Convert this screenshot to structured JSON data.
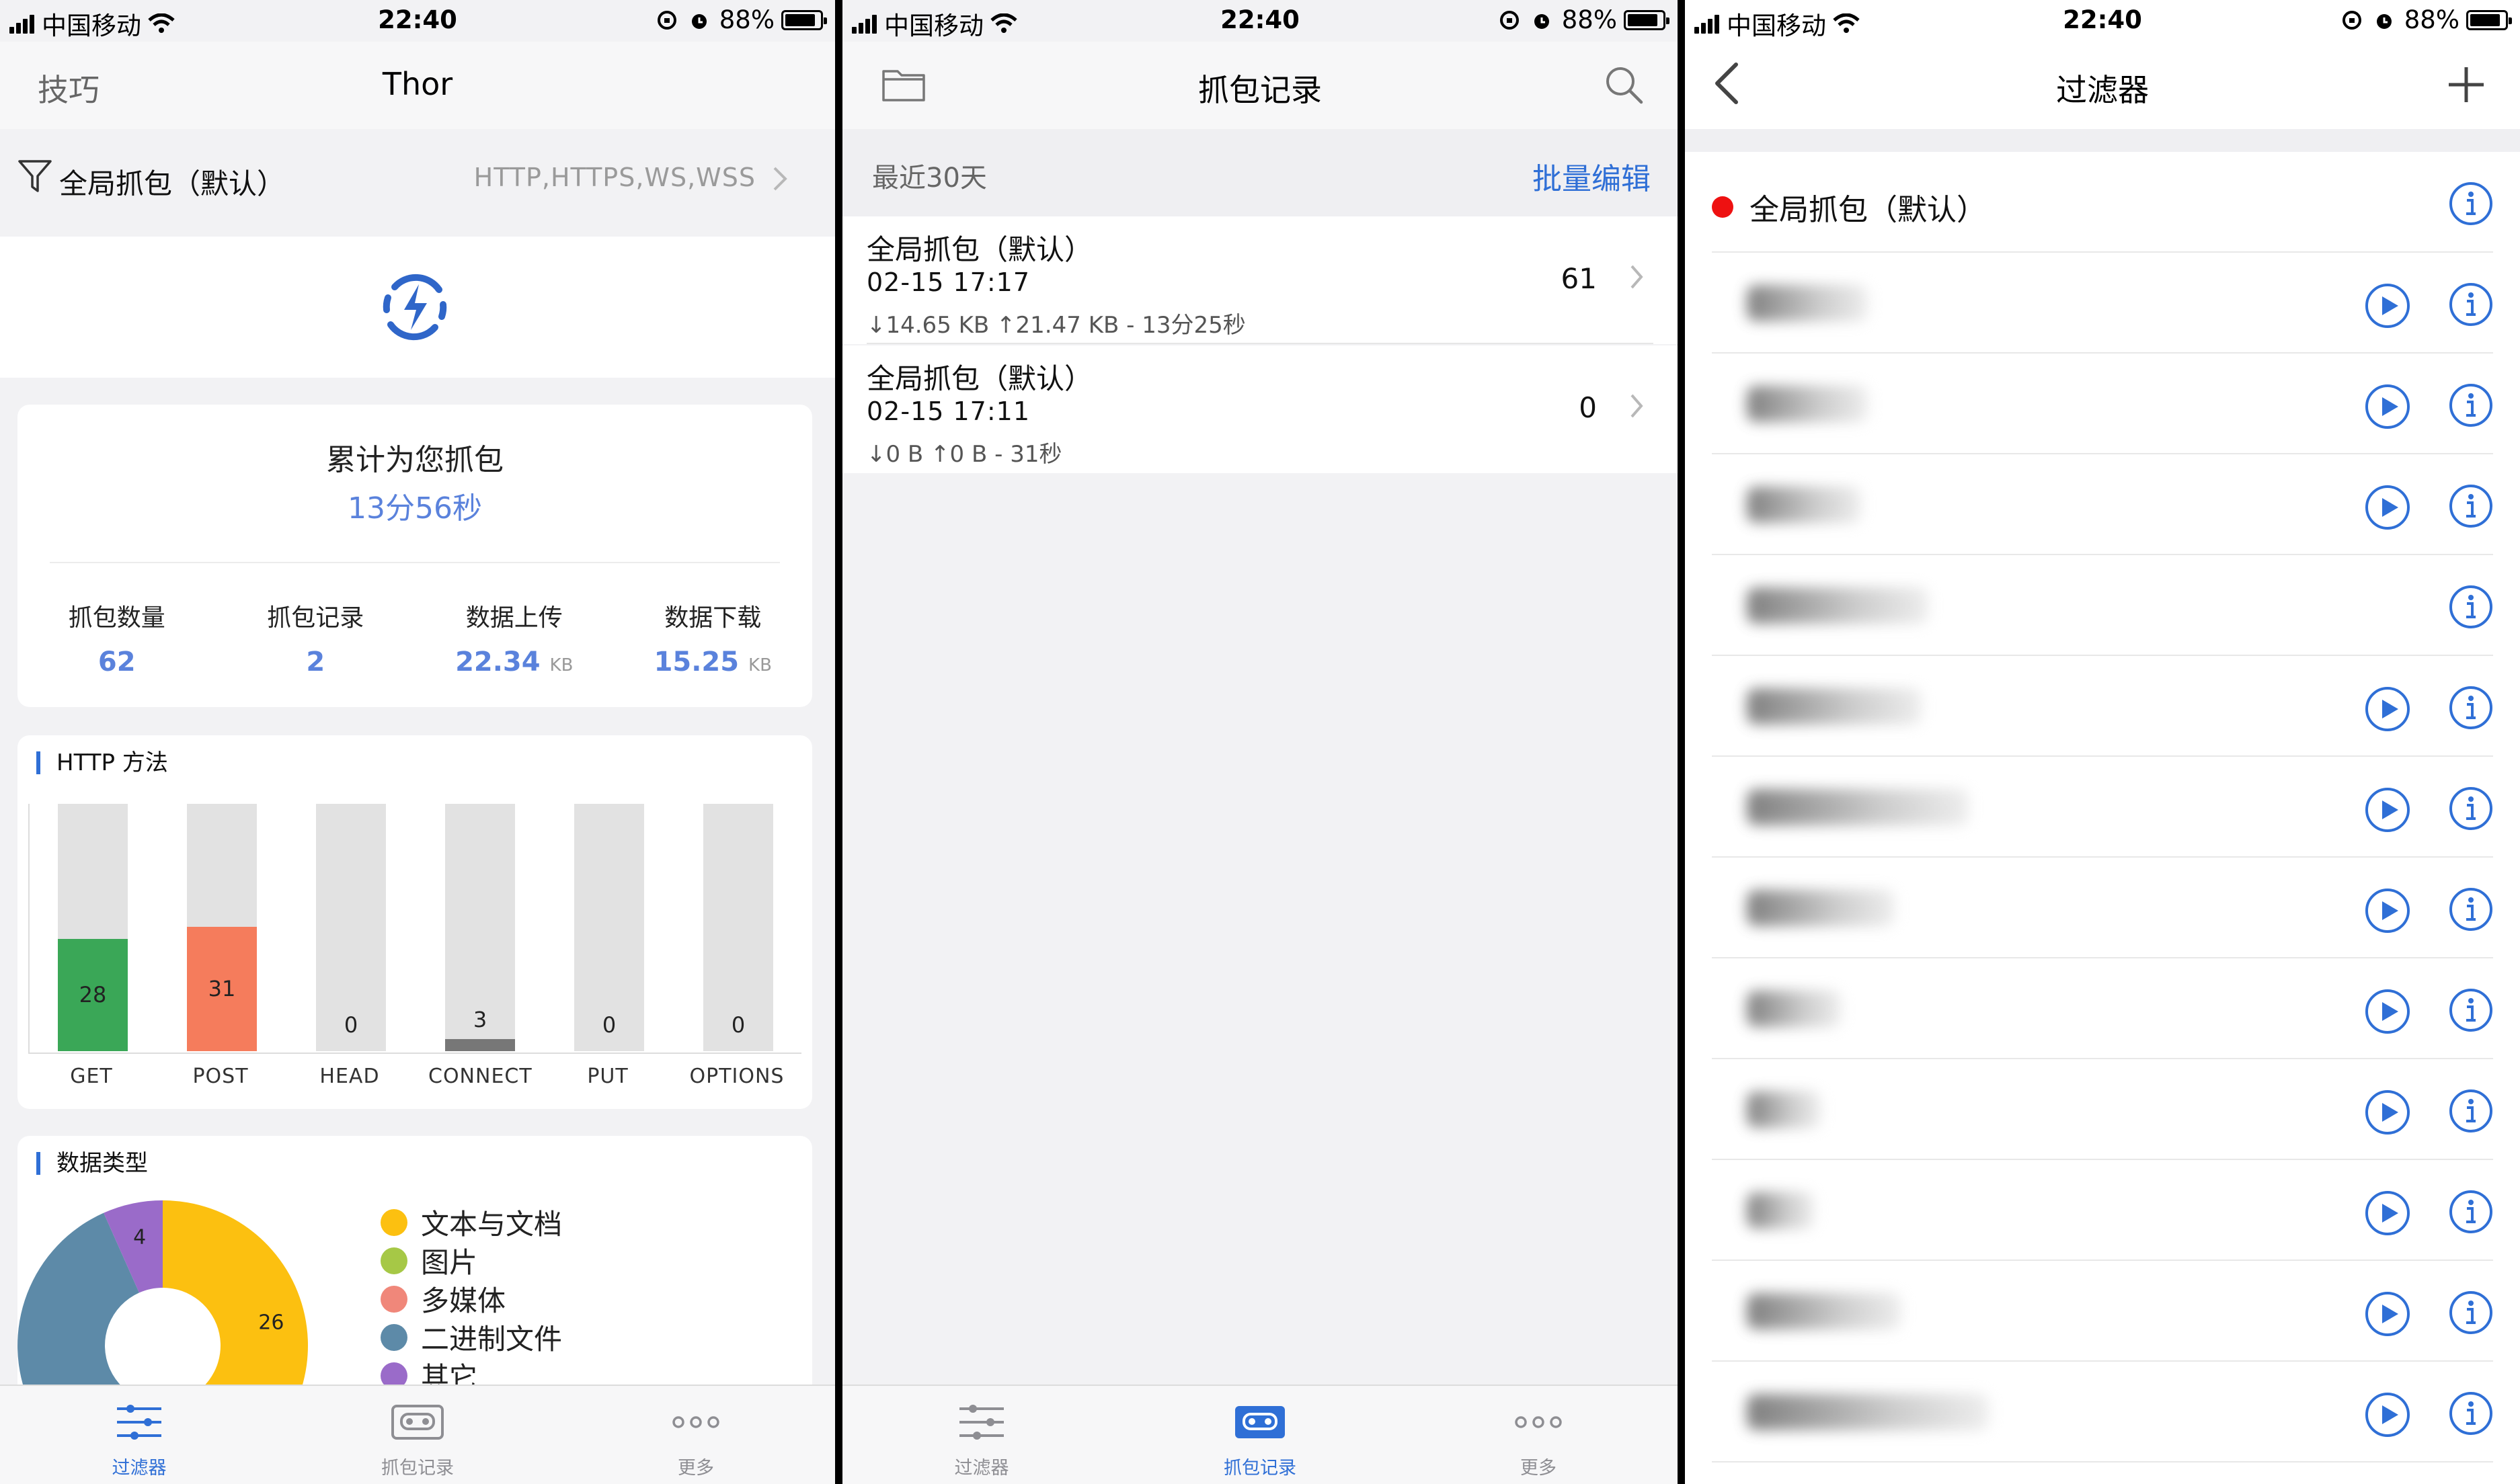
{
  "status": {
    "carrier": "中国移动",
    "time": "22:40",
    "battery": "88%"
  },
  "screen1": {
    "nav_left": "技巧",
    "title": "Thor",
    "filter_name": "全局抓包（默认）",
    "filter_protocols": "HTTP,HTTPS,WS,WSS",
    "summary_title": "累计为您抓包",
    "summary_time": "13分56秒",
    "stats": [
      {
        "label": "抓包数量",
        "value": "62",
        "unit": ""
      },
      {
        "label": "抓包记录",
        "value": "2",
        "unit": ""
      },
      {
        "label": "数据上传",
        "value": "22.34",
        "unit": "KB"
      },
      {
        "label": "数据下载",
        "value": "15.25",
        "unit": "KB"
      }
    ],
    "http_section_title": "HTTP 方法",
    "type_section_title": "数据类型",
    "chart_data": [
      {
        "type": "bar",
        "categories": [
          "GET",
          "POST",
          "HEAD",
          "CONNECT",
          "PUT",
          "OPTIONS"
        ],
        "values": [
          28,
          31,
          0,
          3,
          0,
          0
        ],
        "colors": [
          "#3aa757",
          "#f57c5c",
          "#e2e2e2",
          "#777777",
          "#e2e2e2",
          "#e2e2e2"
        ],
        "ylim": [
          0,
          62
        ]
      },
      {
        "type": "pie",
        "labels": [
          "文本与文档",
          "图片",
          "多媒体",
          "二进制文件",
          "其它"
        ],
        "values": [
          26,
          0,
          0,
          30,
          4
        ],
        "slice_labels": [
          "26",
          "",
          "",
          "",
          "4"
        ],
        "colors": [
          "#fcc010",
          "#a6c846",
          "#f0877a",
          "#5d8aa8",
          "#9a6bc9"
        ]
      }
    ]
  },
  "screen2": {
    "title": "抓包记录",
    "range_label": "最近30天",
    "batch_edit": "批量编辑",
    "records": [
      {
        "name": "全局抓包（默认）",
        "time": "02-15 17:17",
        "traffic": "↓14.65 KB ↑21.47 KB - 13分25秒",
        "count": "61"
      },
      {
        "name": "全局抓包（默认）",
        "time": "02-15 17:11",
        "traffic": "↓0 B ↑0 B - 31秒",
        "count": "0"
      }
    ]
  },
  "screen3": {
    "title": "过滤器",
    "default_filter": "全局抓包（默认）",
    "blurred_rows": [
      {
        "has_play": true,
        "blur_width": 180
      },
      {
        "has_play": true,
        "blur_width": 180
      },
      {
        "has_play": true,
        "blur_width": 170
      },
      {
        "has_play": false,
        "blur_width": 270
      },
      {
        "has_play": true,
        "blur_width": 260
      },
      {
        "has_play": true,
        "blur_width": 330
      },
      {
        "has_play": true,
        "blur_width": 220
      },
      {
        "has_play": true,
        "blur_width": 140
      },
      {
        "has_play": true,
        "blur_width": 110
      },
      {
        "has_play": true,
        "blur_width": 100
      },
      {
        "has_play": true,
        "blur_width": 230
      },
      {
        "has_play": true,
        "blur_width": 360
      }
    ]
  },
  "tabs": [
    {
      "label": "过滤器",
      "icon": "sliders-icon"
    },
    {
      "label": "抓包记录",
      "icon": "tape-icon"
    },
    {
      "label": "更多",
      "icon": "more-icon"
    }
  ],
  "colors": {
    "accent": "#2f6fd6",
    "stat_blue": "#5a82dc",
    "red_dot": "#ee1111"
  }
}
